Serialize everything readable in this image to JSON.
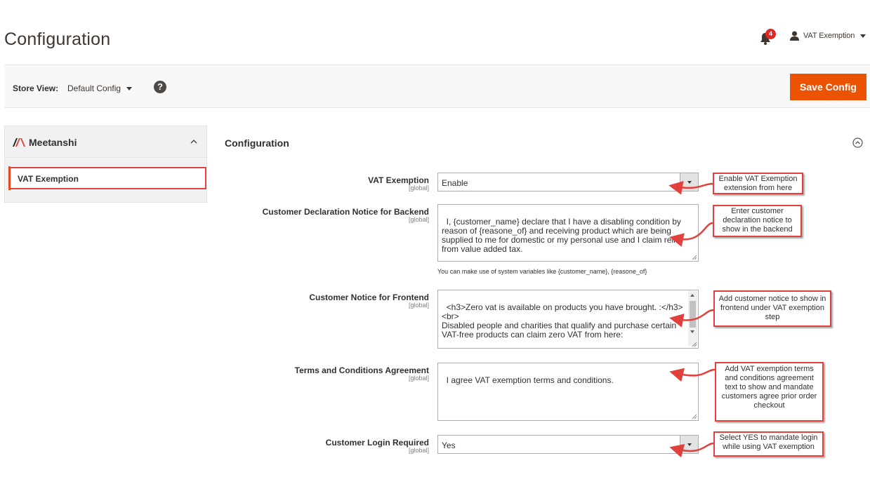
{
  "header": {
    "title": "Configuration",
    "notifications_count": "4",
    "user_name": "VAT Exemption"
  },
  "toolbar": {
    "store_view_label": "Store View:",
    "store_view_value": "Default Config",
    "help_symbol": "?",
    "save_label": "Save Config"
  },
  "sidebar": {
    "brand": "Meetanshi",
    "items": [
      {
        "label": "VAT Exemption"
      }
    ]
  },
  "section": {
    "title": "Configuration"
  },
  "fields": {
    "vat_exemption": {
      "label": "VAT Exemption",
      "scope": "[global]",
      "value": "Enable"
    },
    "backend_notice": {
      "label": "Customer Declaration Notice for Backend",
      "scope": "[global]",
      "value": "I, {customer_name} declare that I have a disabling condition by\nreason of {reasone_of} and receiving product which are being\nsupplied to me for domestic or my personal use and I claim relief\nfrom value added tax.",
      "hint": "You can make use of system variables like {customer_name}, {reasone_of}"
    },
    "frontend_notice": {
      "label": "Customer Notice for Frontend",
      "scope": "[global]",
      "value": "<h3>Zero vat is available on products you have brought. :</h3>\n<br>\nDisabled people and charities that qualify and purchase certain\nVAT-free products can claim zero VAT from here:"
    },
    "terms": {
      "label": "Terms and Conditions Agreement",
      "scope": "[global]",
      "value": "I agree VAT exemption terms and conditions."
    },
    "login_required": {
      "label": "Customer Login Required",
      "scope": "[global]",
      "value": "Yes"
    }
  },
  "callouts": {
    "vat": "Enable VAT Exemption extension from here",
    "backend": "Enter customer declaration notice to show in the backend",
    "frontend": "Add customer notice to show in frontend under VAT exemption step",
    "terms": "Add VAT exemption terms and conditions agreement text to show and mandate customers agree prior order checkout",
    "login": "Select YES to mandate login while using VAT exemption"
  },
  "colors": {
    "accent": "#eb5202",
    "annotation_red": "#e2403c",
    "badge": "#e22626"
  }
}
